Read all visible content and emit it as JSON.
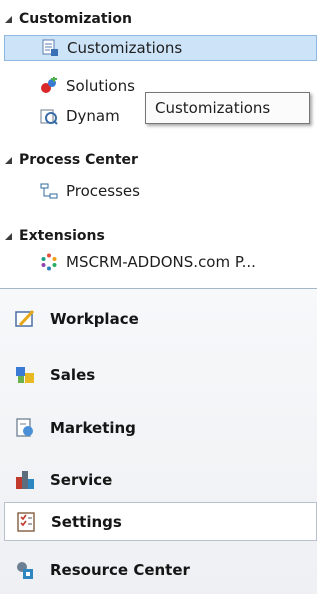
{
  "tree": {
    "groups": [
      {
        "label": "Customization",
        "items": [
          "Customizations",
          "Solutions",
          "Dynam"
        ]
      },
      {
        "label": "Process Center",
        "items": [
          "Processes"
        ]
      },
      {
        "label": "Extensions",
        "items": [
          "MSCRM-ADDONS.com P..."
        ]
      }
    ],
    "tooltip": "Customizations"
  },
  "nav": {
    "items": [
      "Workplace",
      "Sales",
      "Marketing",
      "Service",
      "Settings",
      "Resource Center"
    ]
  }
}
